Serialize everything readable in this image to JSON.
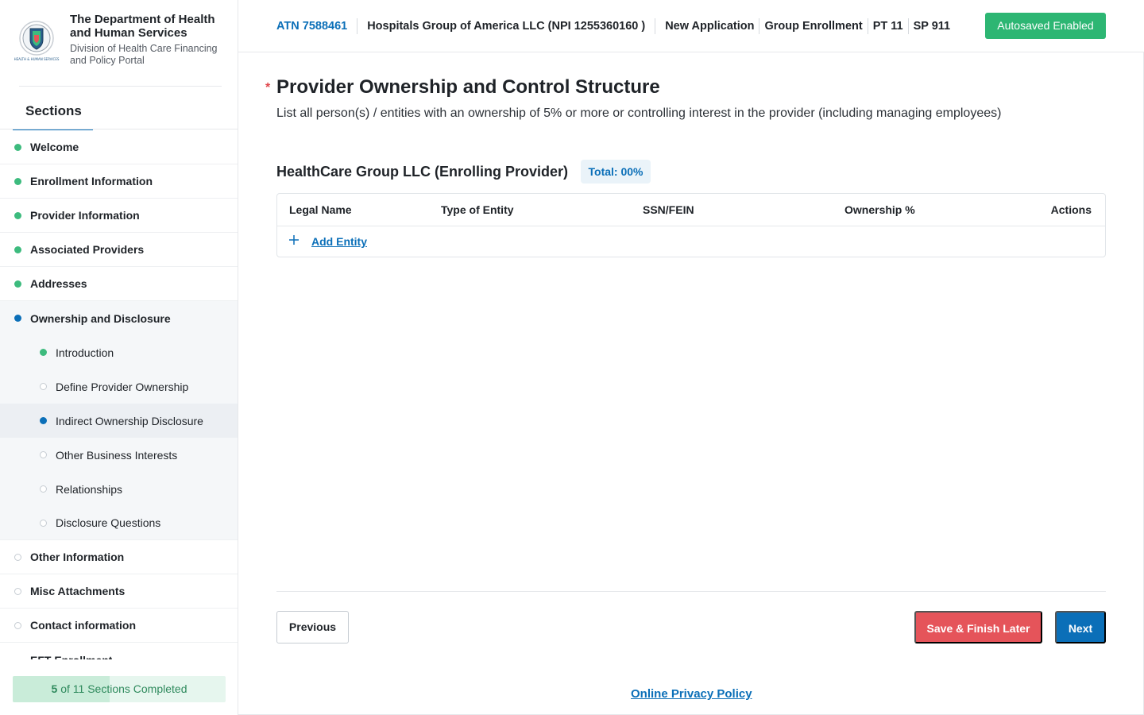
{
  "brand": {
    "title": "The Department of Health and Human Services",
    "subtitle": "Division of Health Care Financing and Policy Portal",
    "logo_text": "HEALTH & HUMAN SERVICES"
  },
  "sidebar": {
    "tab_label": "Sections",
    "items": [
      {
        "label": "Welcome",
        "status": "done"
      },
      {
        "label": "Enrollment Information",
        "status": "done"
      },
      {
        "label": "Provider Information",
        "status": "done"
      },
      {
        "label": "Associated Providers",
        "status": "done"
      },
      {
        "label": "Addresses",
        "status": "done"
      },
      {
        "label": "Ownership and Disclosure",
        "status": "current"
      },
      {
        "label": "Other Information",
        "status": "todo"
      },
      {
        "label": "Misc Attachments",
        "status": "todo"
      },
      {
        "label": "Contact information",
        "status": "todo"
      },
      {
        "label": "EFT Enrollment",
        "status": "todo"
      }
    ],
    "subitems": [
      {
        "label": "Introduction",
        "status": "done"
      },
      {
        "label": "Define Provider Ownership",
        "status": "todo"
      },
      {
        "label": "Indirect Ownership Disclosure",
        "status": "current"
      },
      {
        "label": "Other Business Interests",
        "status": "todo"
      },
      {
        "label": "Relationships",
        "status": "todo"
      },
      {
        "label": "Disclosure Questions",
        "status": "todo"
      }
    ],
    "progress": {
      "completed": "5",
      "text": "of 11 Sections Completed",
      "fraction": 0.4545
    }
  },
  "topbar": {
    "atn": "ATN 7588461",
    "org": "Hospitals Group of America LLC (NPI 1255360160 )",
    "app_type": "New Application",
    "enrollment": "Group Enrollment",
    "pt": "PT 11",
    "sp": "SP 911",
    "autosave": "Autosaved Enabled"
  },
  "main": {
    "required_mark": "*",
    "title": "Provider Ownership and Control Structure",
    "description": "List all person(s) / entities with an ownership of 5% or more or controlling interest in the provider (including managing employees)",
    "provider_name": "HealthCare Group LLC (Enrolling Provider)",
    "total_badge": "Total: 00%",
    "table": {
      "columns": [
        "Legal Name",
        "Type of Entity",
        "SSN/FEIN",
        "Ownership %",
        "Actions"
      ],
      "add_label": "Add Entity"
    },
    "buttons": {
      "previous": "Previous",
      "save": "Save & Finish Later",
      "next": "Next"
    },
    "privacy": "Online Privacy Policy"
  },
  "colors": {
    "accent": "#0b6fb8",
    "done": "#3dbb7e",
    "autosave": "#2db673",
    "save_button": "#e5545a"
  }
}
